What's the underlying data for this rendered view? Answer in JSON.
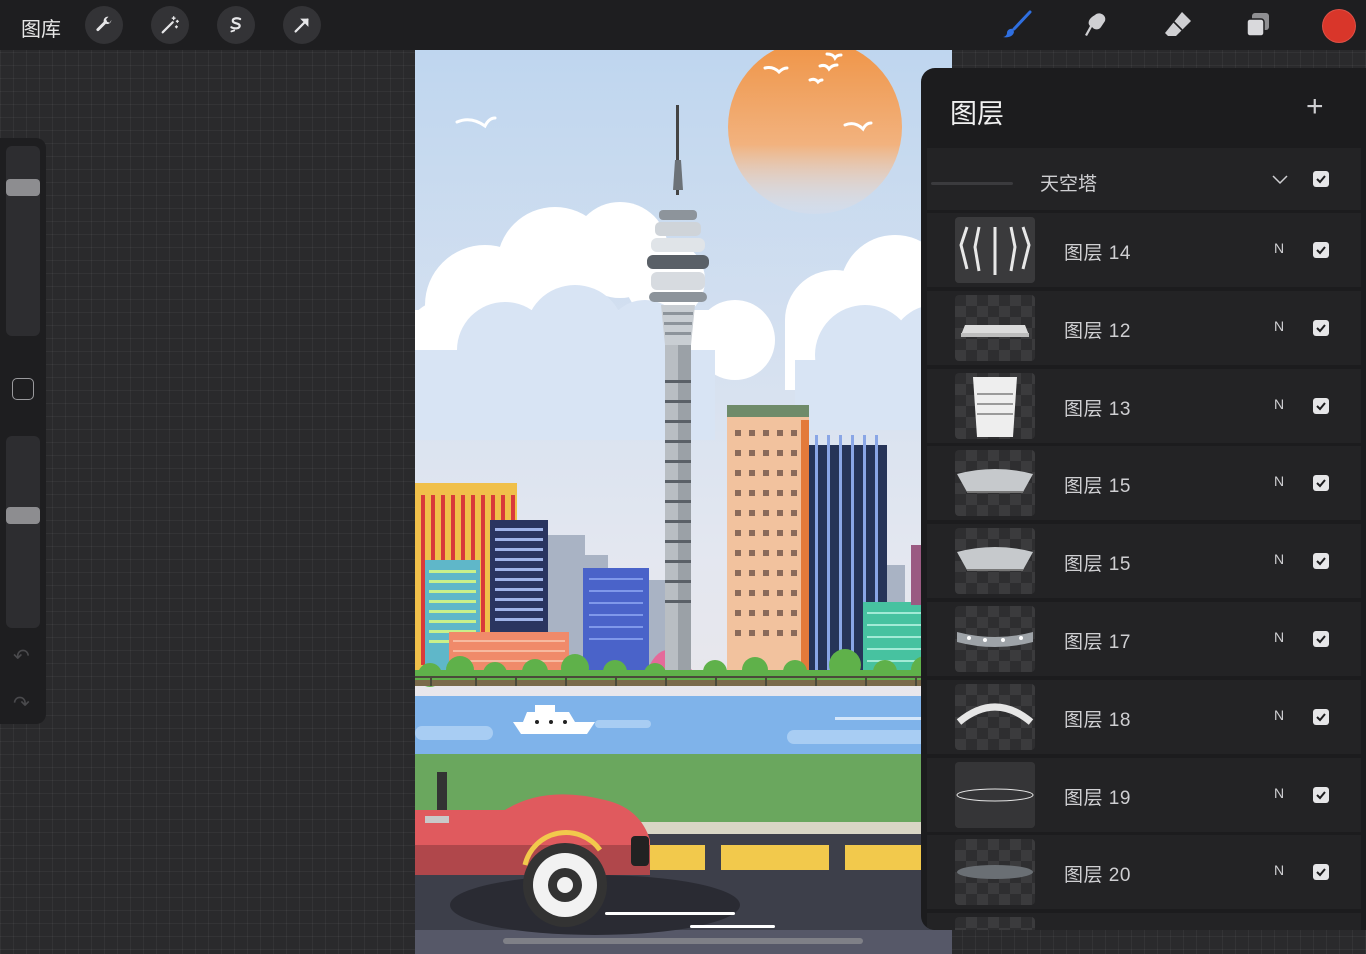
{
  "topbar": {
    "gallery_label": "图库",
    "tools_left": [
      {
        "name": "actions",
        "icon": "wrench-icon"
      },
      {
        "name": "adjustments",
        "icon": "magic-wand-icon"
      },
      {
        "name": "selection",
        "icon": "selection-s-icon"
      },
      {
        "name": "transform",
        "icon": "arrow-cursor-icon"
      }
    ],
    "tools_right": [
      {
        "name": "brush",
        "icon": "brush-icon"
      },
      {
        "name": "smudge",
        "icon": "smudge-icon"
      },
      {
        "name": "eraser",
        "icon": "eraser-icon"
      },
      {
        "name": "layers",
        "icon": "layers-icon"
      }
    ],
    "active_color": "#d9362a",
    "accent_color": "#2f6fe0"
  },
  "sidebar": {
    "size_slider_level": 0.17,
    "opacity_slider_level": 0.42
  },
  "layers_panel": {
    "title": "图层",
    "add_label": "+",
    "group": {
      "name": "天空塔",
      "visible": true
    },
    "layers": [
      {
        "name": "图层 14",
        "mode": "N",
        "visible": true
      },
      {
        "name": "图层 12",
        "mode": "N",
        "visible": true
      },
      {
        "name": "图层 13",
        "mode": "N",
        "visible": true
      },
      {
        "name": "图层 15",
        "mode": "N",
        "visible": true
      },
      {
        "name": "图层 15",
        "mode": "N",
        "visible": true
      },
      {
        "name": "图层 17",
        "mode": "N",
        "visible": true
      },
      {
        "name": "图层 18",
        "mode": "N",
        "visible": true
      },
      {
        "name": "图层 19",
        "mode": "N",
        "visible": true
      },
      {
        "name": "图层 20",
        "mode": "N",
        "visible": true
      }
    ]
  }
}
